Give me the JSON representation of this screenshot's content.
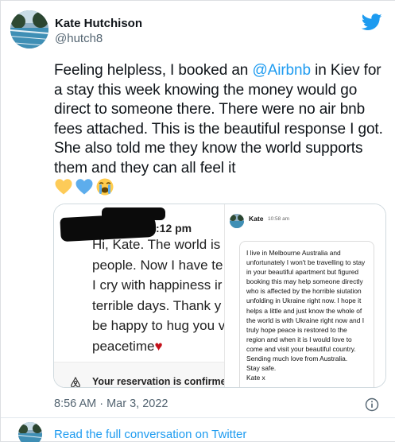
{
  "user": {
    "name": "Kate Hutchison",
    "handle": "@hutch8"
  },
  "tweet": {
    "text_before_mention": "Feeling helpless, I booked an ",
    "mention": "@Airbnb",
    "text_after_mention": " in Kiev for a stay this week knowing the money would go direct to someone there. There were no air bnb fees attached. This is the beautiful response I got. She also told me they know the world supports them and they can all feel it",
    "emojis": [
      "yellow-heart",
      "blue-heart",
      "loudly-crying-face"
    ]
  },
  "media": {
    "left_screenshot": {
      "time": ":12 pm",
      "message_lines": [
        "Hi, Kate. The world is r",
        "people. Now I have te",
        "I cry with happiness ir",
        "terrible days. Thank y",
        "be happy to hug you v",
        "peacetime"
      ],
      "heart": "♥",
      "reservation_text": "Your reservation is confirme"
    },
    "right_screenshot": {
      "sender": "Kate",
      "time": "10:58 am",
      "message": "I live in Melbourne Australia and unfortunately I won't be travelling to stay in your beautiful apartment but figured booking this may help someone directly who is affected by the horrible siutation unfolding in Ukraine right now. I hope it helps a little and just know the whole of the world is with Ukraine right now and I truly hope peace is restored to the region and when it is I would love to come and visit your beautiful country.\nSending much love from Australia.\nStay safe.\nKate x"
    }
  },
  "meta": {
    "timestamp": "8:56 AM · Mar 3, 2022"
  },
  "footer": {
    "read_link": "Read the full conversation on Twitter"
  },
  "colors": {
    "link_blue": "#1d9bf0",
    "secondary_text": "#536471",
    "primary_text": "#0f1419"
  },
  "icons": {
    "brand": "twitter-bird-icon",
    "info": "info-icon",
    "airbnb": "airbnb-logo-icon"
  }
}
